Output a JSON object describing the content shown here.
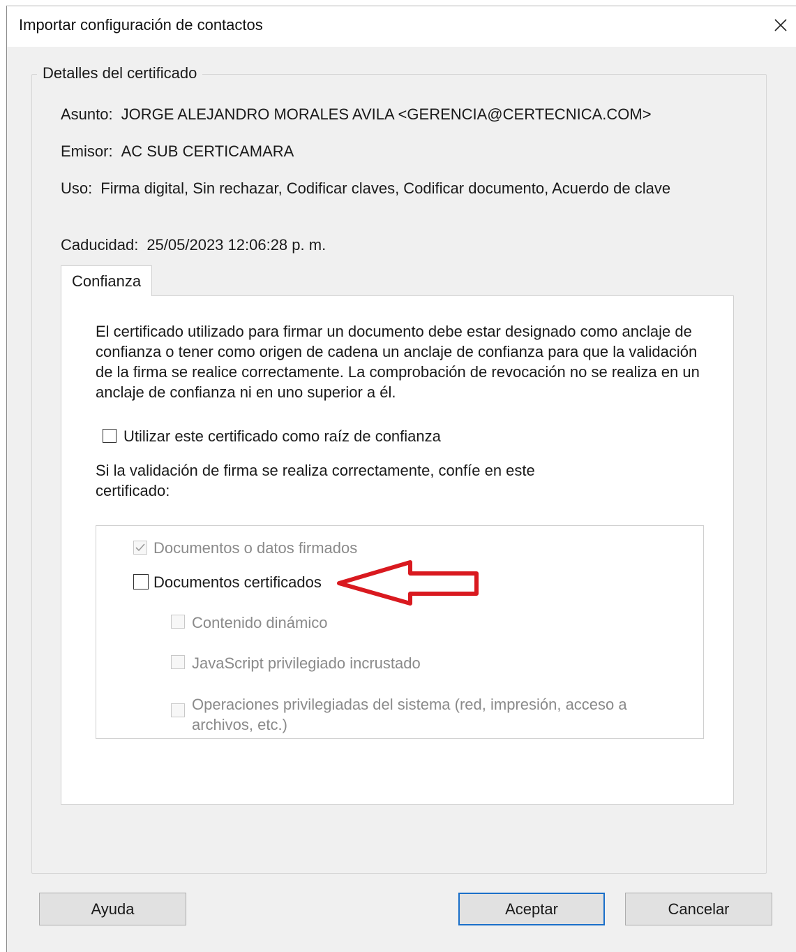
{
  "dialog": {
    "title": "Importar configuración de contactos"
  },
  "details": {
    "legend": "Detalles del certificado",
    "subject_label": "Asunto:",
    "subject_value": "JORGE ALEJANDRO MORALES AVILA <GERENCIA@CERTECNICA.COM>",
    "issuer_label": "Emisor:",
    "issuer_value": "AC SUB CERTICAMARA",
    "usage_label": "Uso:",
    "usage_value": "Firma digital, Sin rechazar, Codificar claves, Codificar documento, Acuerdo de clave",
    "expiry_label": "Caducidad:",
    "expiry_value": "25/05/2023 12:06:28 p. m."
  },
  "tabs": [
    {
      "label": "Confianza",
      "selected": true
    }
  ],
  "trust": {
    "description": "El certificado utilizado para firmar un documento debe estar designado como anclaje de confianza o tener como origen de cadena un anclaje de confianza para que la validación de la firma se realice correctamente. La comprobación de revocación no se realiza en un anclaje de confianza ni en uno superior a él.",
    "root_checkbox": {
      "label": "Utilizar este certificado como raíz de confianza",
      "checked": false,
      "enabled": true
    },
    "question": "Si la validación de firma se realiza correctamente, confíe en este certificado:",
    "options": [
      {
        "label": "Documentos o datos firmados",
        "checked": true,
        "enabled": false
      },
      {
        "label": "Documentos certificados",
        "checked": false,
        "enabled": true
      },
      {
        "label": "Contenido dinámico",
        "checked": false,
        "enabled": false
      },
      {
        "label": "JavaScript privilegiado incrustado",
        "checked": false,
        "enabled": false
      },
      {
        "label": "Operaciones privilegiadas del sistema (red, impresión, acceso a archivos, etc.)",
        "checked": false,
        "enabled": false
      }
    ]
  },
  "buttons": {
    "help": "Ayuda",
    "ok": "Aceptar",
    "cancel": "Cancelar"
  },
  "annotation": {
    "arrow_color": "#d9191f"
  },
  "icons": {
    "close": "close-icon",
    "check": "check-icon",
    "arrow": "red-arrow-annotation"
  }
}
